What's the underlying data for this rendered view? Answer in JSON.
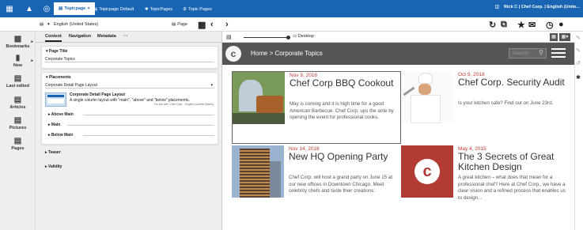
{
  "colors": {
    "topbar": "#1a65b3",
    "accent": "#c23a34",
    "header": "#555555"
  },
  "topbar": {
    "tabs": [
      {
        "label": "Topicpage",
        "icon": "topic-icon",
        "active": true
      },
      {
        "label": "Topicpage Default",
        "icon": "topic-icon"
      },
      {
        "label": "TopicPages",
        "icon": "star-icon"
      },
      {
        "label": "Topic Pages",
        "icon": "gear-icon"
      }
    ],
    "user": "Rick C | Chef Corp. | English (Unite..."
  },
  "toolbar": {
    "locale": "English (United States)",
    "doc_type": "Page",
    "preview_device": "Desktop"
  },
  "leftnav": [
    {
      "label": "Bookmarks",
      "icon": "bookmark-icon"
    },
    {
      "label": "New",
      "icon": "new-document-icon"
    },
    {
      "label": "Last edited",
      "icon": "document-icon"
    },
    {
      "label": "Articles",
      "icon": "article-icon"
    },
    {
      "label": "Pictures",
      "icon": "picture-icon"
    },
    {
      "label": "Pages",
      "icon": "pages-icon"
    }
  ],
  "panel": {
    "tabs": [
      "Content",
      "Navigation",
      "Metadata",
      "···"
    ],
    "page_title_label": "Page Title",
    "page_title_value": "Corporate Topics",
    "placements_label": "Placements",
    "placement_select": "Corporate Detail Page Layout",
    "layout_name": "Corporate Detail Page Layout",
    "layout_desc": "A single column layout with \"main\", \"above\" and \"below\" placements.",
    "layout_meta": "For the site: Chef Corp. - English (United States)",
    "sections": [
      "Above Main",
      "Main",
      "Below Main"
    ],
    "collapsed": [
      "Teaser",
      "Validity"
    ]
  },
  "site": {
    "breadcrumb": "Home > Corporate Topics",
    "search_placeholder": "Search",
    "teasers": [
      {
        "date": "Nov 9, 2018",
        "title": "Chef Corp BBQ Cookout",
        "text": "May is coming and it is high time for a good American Barbecue. Chef Corp. ups the ante by opening the event for professional cooks."
      },
      {
        "date": "Oct 9, 2018",
        "title": "Chef Corp. Security Audit",
        "text": "Is your kitchen safe? Find out on June 23rd."
      },
      {
        "date": "Nov 14, 2018",
        "title": "New HQ Opening Party",
        "text": "Chef Corp. will host a grand party on June 15 at our new offices in Downtown Chicago. Meet celebrity chefs and taste their creations."
      },
      {
        "date": "May 4, 2015",
        "title": "The 3 Secrets of Great Kitchen Design",
        "text": "A great kitchen – what does that mean for a professional chef? Here at Chef Corp., we have a clear vision and a refined process that enables us to design..."
      }
    ]
  }
}
